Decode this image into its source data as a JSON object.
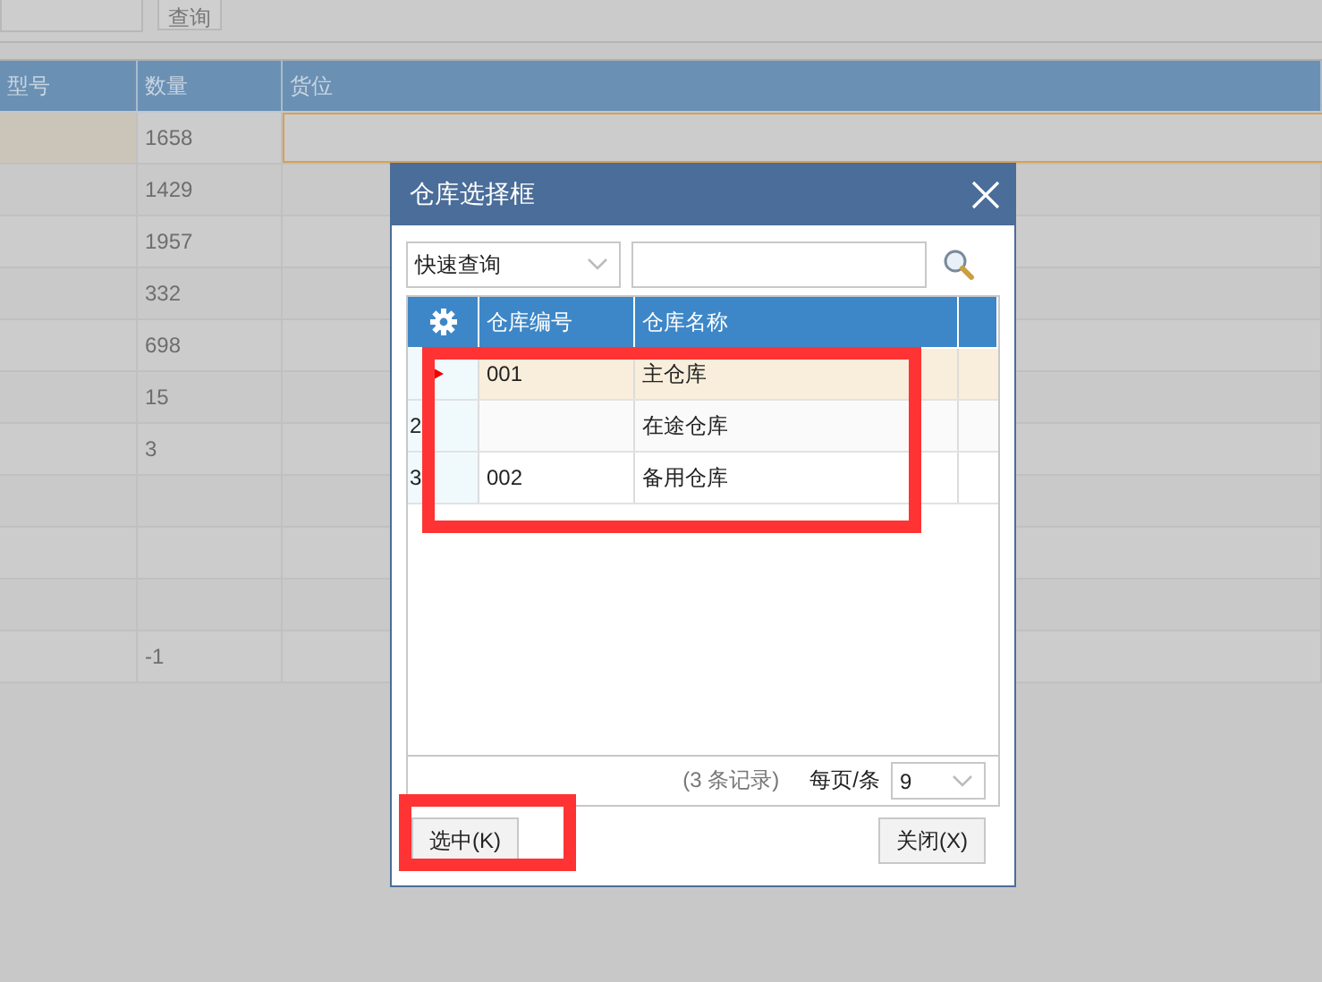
{
  "toolbar": {
    "search_button": "查询"
  },
  "table": {
    "columns": [
      "型号",
      "数量",
      "货位"
    ],
    "rows": [
      {
        "cells": [
          "",
          "1658",
          ""
        ],
        "selected": true
      },
      {
        "cells": [
          "",
          "1429",
          ""
        ],
        "selected": false
      },
      {
        "cells": [
          "",
          "1957",
          ""
        ],
        "selected": false
      },
      {
        "cells": [
          "",
          "332",
          ""
        ],
        "selected": false
      },
      {
        "cells": [
          "",
          "698",
          ""
        ],
        "selected": false
      },
      {
        "cells": [
          "",
          "15",
          ""
        ],
        "selected": false
      },
      {
        "cells": [
          "",
          "3",
          ""
        ],
        "selected": false
      },
      {
        "cells": [
          "",
          "",
          ""
        ],
        "selected": false
      },
      {
        "cells": [
          "",
          "",
          ""
        ],
        "selected": false
      },
      {
        "cells": [
          "",
          "",
          ""
        ],
        "selected": false
      },
      {
        "cells": [
          "",
          "-1",
          ""
        ],
        "selected": false
      }
    ]
  },
  "dialog": {
    "title": "仓库选择框",
    "filter": {
      "value": "快速查询"
    },
    "grid": {
      "columns": [
        "仓库编号",
        "仓库名称"
      ],
      "highlighted": true,
      "rows": [
        {
          "number": "",
          "code": "001",
          "name": "主仓库",
          "selected": true
        },
        {
          "number": "2",
          "code": "",
          "name": "在途仓库",
          "selected": false
        },
        {
          "number": "3",
          "code": "002",
          "name": "备用仓库",
          "selected": false
        }
      ]
    },
    "record_count": "(3 条记录)",
    "page_size_label": "每页/条",
    "page_size": "9",
    "buttons": [
      {
        "label": "选中(K)",
        "highlighted": true
      },
      {
        "label": "关闭(X)",
        "highlighted": false
      }
    ]
  }
}
